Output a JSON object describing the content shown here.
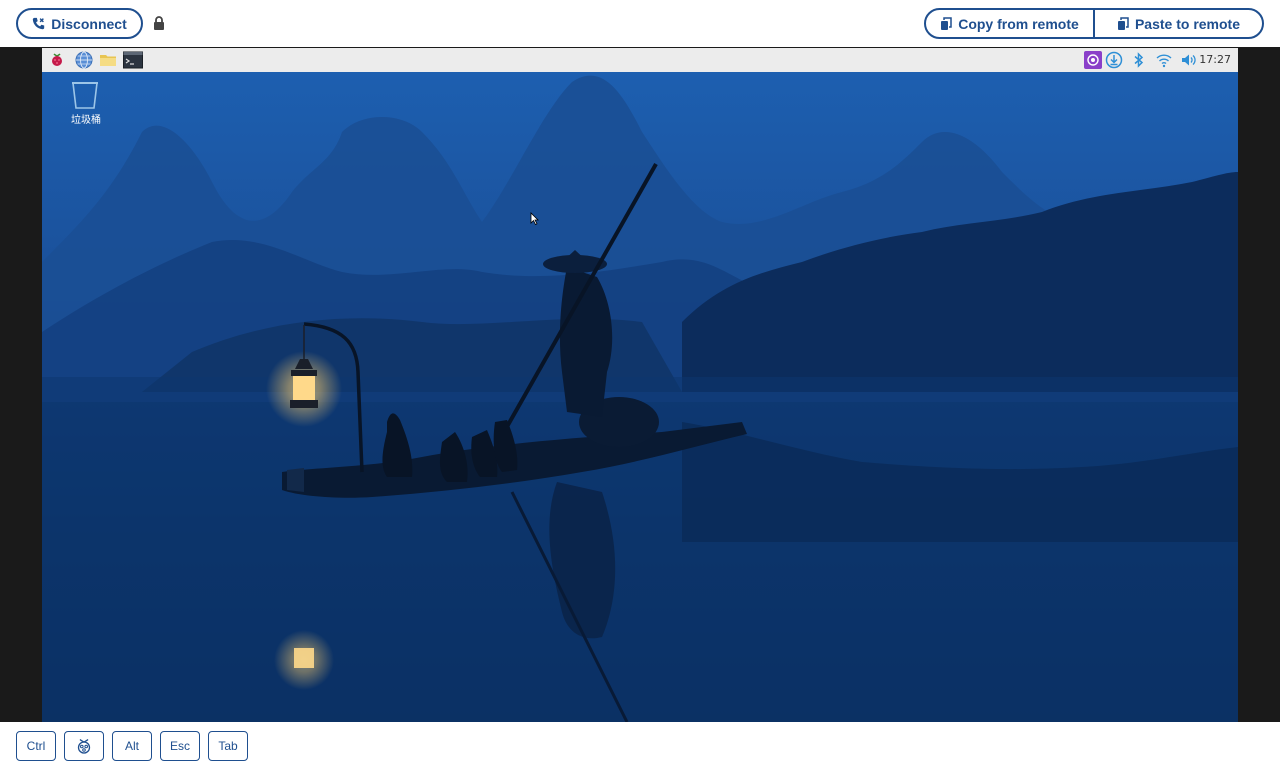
{
  "toolbar": {
    "disconnect_label": "Disconnect",
    "copy_label": "Copy from remote",
    "paste_label": "Paste to remote"
  },
  "remote": {
    "taskbar": {
      "clock": "17:27",
      "left_icons": [
        "raspberry-menu-icon",
        "web-browser-icon",
        "file-manager-icon",
        "terminal-icon"
      ],
      "tray_icons": [
        "vnc-icon",
        "updates-icon",
        "bluetooth-icon",
        "wifi-icon",
        "volume-icon"
      ]
    },
    "desktop": {
      "trash_label": "垃圾桶"
    }
  },
  "keys": {
    "ctrl": "Ctrl",
    "alt": "Alt",
    "esc": "Esc",
    "tab": "Tab"
  },
  "colors": {
    "accent": "#1f4f8f",
    "frame": "#1a1a1a",
    "taskbar": "#ececec",
    "lantern": "#ffcf6b"
  }
}
